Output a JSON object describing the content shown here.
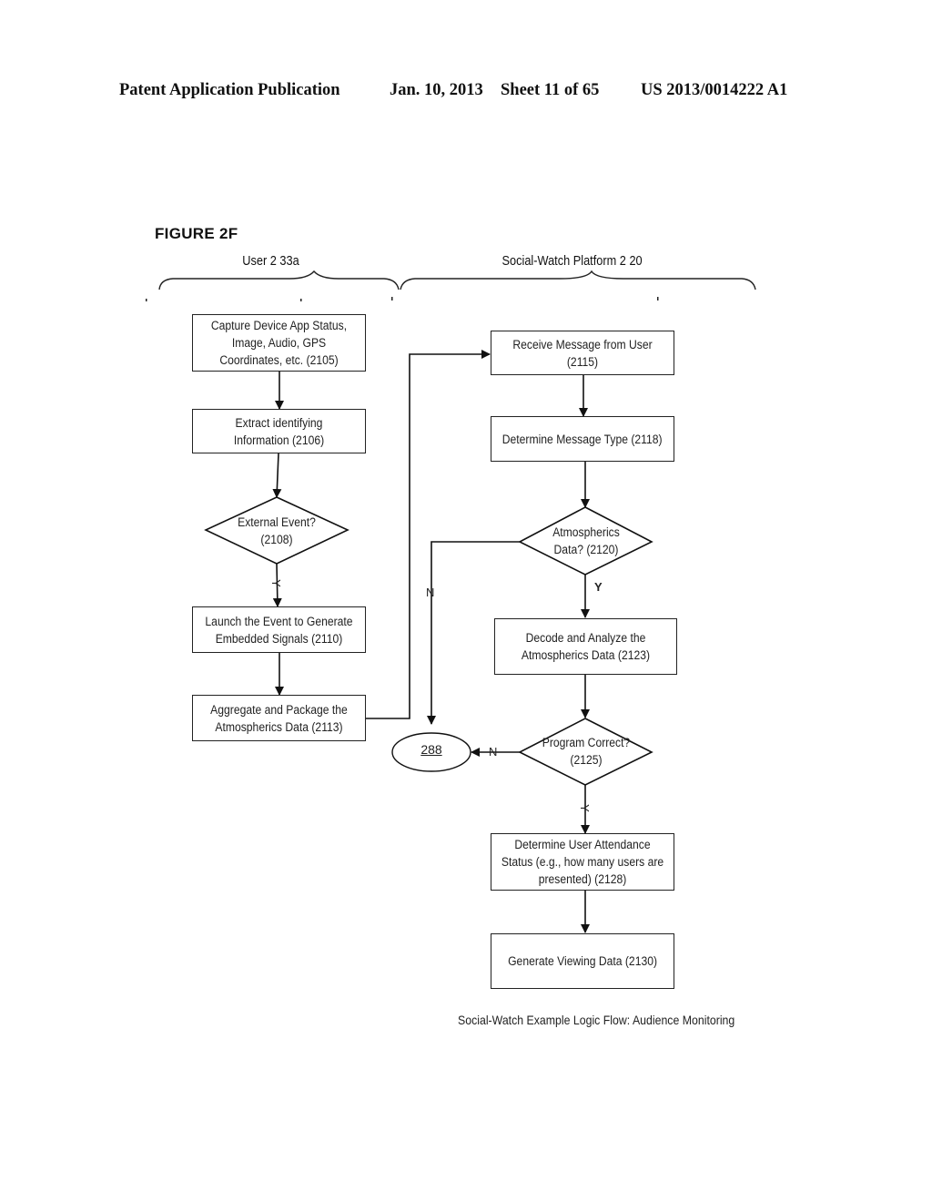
{
  "header": {
    "publication": "Patent Application Publication",
    "date": "Jan. 10, 2013",
    "sheet": "Sheet 11 of 65",
    "number": "US 2013/0014222 A1"
  },
  "figure": {
    "title": "FIGURE 2F",
    "caption": "Social-Watch Example Logic Flow: Audience Monitoring",
    "lanes": [
      {
        "label": "User 2 33a"
      },
      {
        "label": "Social-Watch  Platform 2 20"
      }
    ]
  },
  "nodes": {
    "n2105": {
      "type": "process",
      "text": "Capture Device App Status, Image, Audio, GPS Coordinates, etc.  (2105)"
    },
    "n2106": {
      "type": "process",
      "text": "Extract identifying Information (2106)"
    },
    "n2108": {
      "type": "decision",
      "line1": "External Event?",
      "line2": "(2108)"
    },
    "n2110": {
      "type": "process",
      "text": "Launch the Event to Generate Embedded Signals (2110)"
    },
    "n2113": {
      "type": "process",
      "text": "Aggregate and Package the Atmospherics Data (2113)"
    },
    "n2115": {
      "type": "process",
      "text": "Receive Message from User (2115)"
    },
    "n2118": {
      "type": "process",
      "text": "Determine Message Type (2118)"
    },
    "n2120": {
      "type": "decision",
      "line1": "Atmospherics",
      "line2": "Data? (2120)"
    },
    "n2123": {
      "type": "process",
      "text": "Decode and Analyze the Atmospherics Data (2123)"
    },
    "n2125": {
      "type": "decision",
      "line1": "Program Correct?",
      "line2": "(2125)"
    },
    "n2128": {
      "type": "process",
      "text": "Determine User Attendance Status (e.g., how many users are presented) (2128)"
    },
    "n2130": {
      "type": "process",
      "text": "Generate Viewing Data (2130)"
    },
    "n288": {
      "type": "terminal",
      "text": "288"
    }
  },
  "edge_labels": {
    "e2108_yes": "Y",
    "e2120_yes": "Y",
    "e2120_no": "N",
    "e2125_no": "N",
    "e2125_yes": "Y"
  },
  "edges": [
    {
      "from": "n2105",
      "to": "n2106"
    },
    {
      "from": "n2106",
      "to": "n2108"
    },
    {
      "from": "n2108",
      "to": "n2110",
      "label": "Y"
    },
    {
      "from": "n2110",
      "to": "n2113"
    },
    {
      "from": "n2113",
      "to": "n2115"
    },
    {
      "from": "n2115",
      "to": "n2118"
    },
    {
      "from": "n2118",
      "to": "n2120"
    },
    {
      "from": "n2120",
      "to": "n2123",
      "label": "Y"
    },
    {
      "from": "n2120",
      "to": "n288",
      "label": "N"
    },
    {
      "from": "n2123",
      "to": "n2125"
    },
    {
      "from": "n2125",
      "to": "n288",
      "label": "N"
    },
    {
      "from": "n2125",
      "to": "n2128",
      "label": "Y"
    },
    {
      "from": "n2128",
      "to": "n2130"
    }
  ]
}
